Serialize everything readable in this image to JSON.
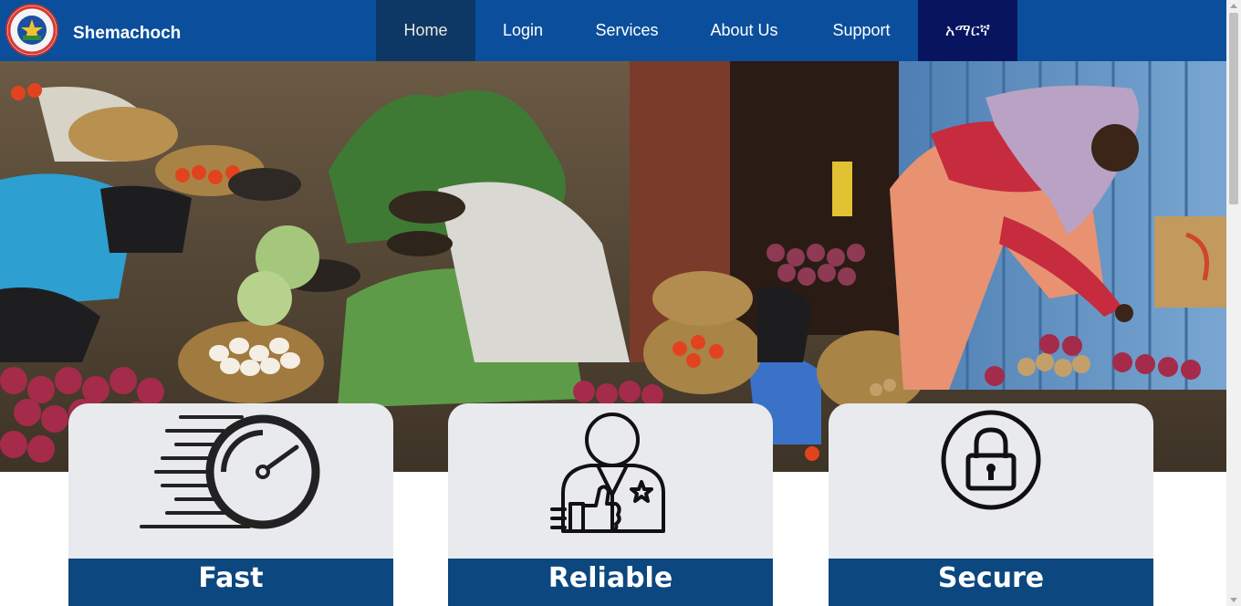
{
  "brand": {
    "name": "Shemachoch",
    "logo_icon": "emblem-logo-icon"
  },
  "nav": {
    "items": [
      {
        "label": "Home",
        "active": true
      },
      {
        "label": "Login"
      },
      {
        "label": "Services"
      },
      {
        "label": "About Us"
      },
      {
        "label": "Support"
      },
      {
        "label": "አማርኛ",
        "language": true
      }
    ]
  },
  "hero": {
    "image": "market-vendor-photo"
  },
  "features": [
    {
      "title": "Fast",
      "icon": "speedometer-icon"
    },
    {
      "title": "Reliable",
      "icon": "person-thumbs-up-icon"
    },
    {
      "title": "Secure",
      "icon": "padlock-icon"
    }
  ],
  "colors": {
    "navbar": "#0b4f9c",
    "active_tab": "#0d3866",
    "language_tab": "#08155e",
    "card_label": "#0d477f",
    "card_bg": "#e9eaee"
  }
}
